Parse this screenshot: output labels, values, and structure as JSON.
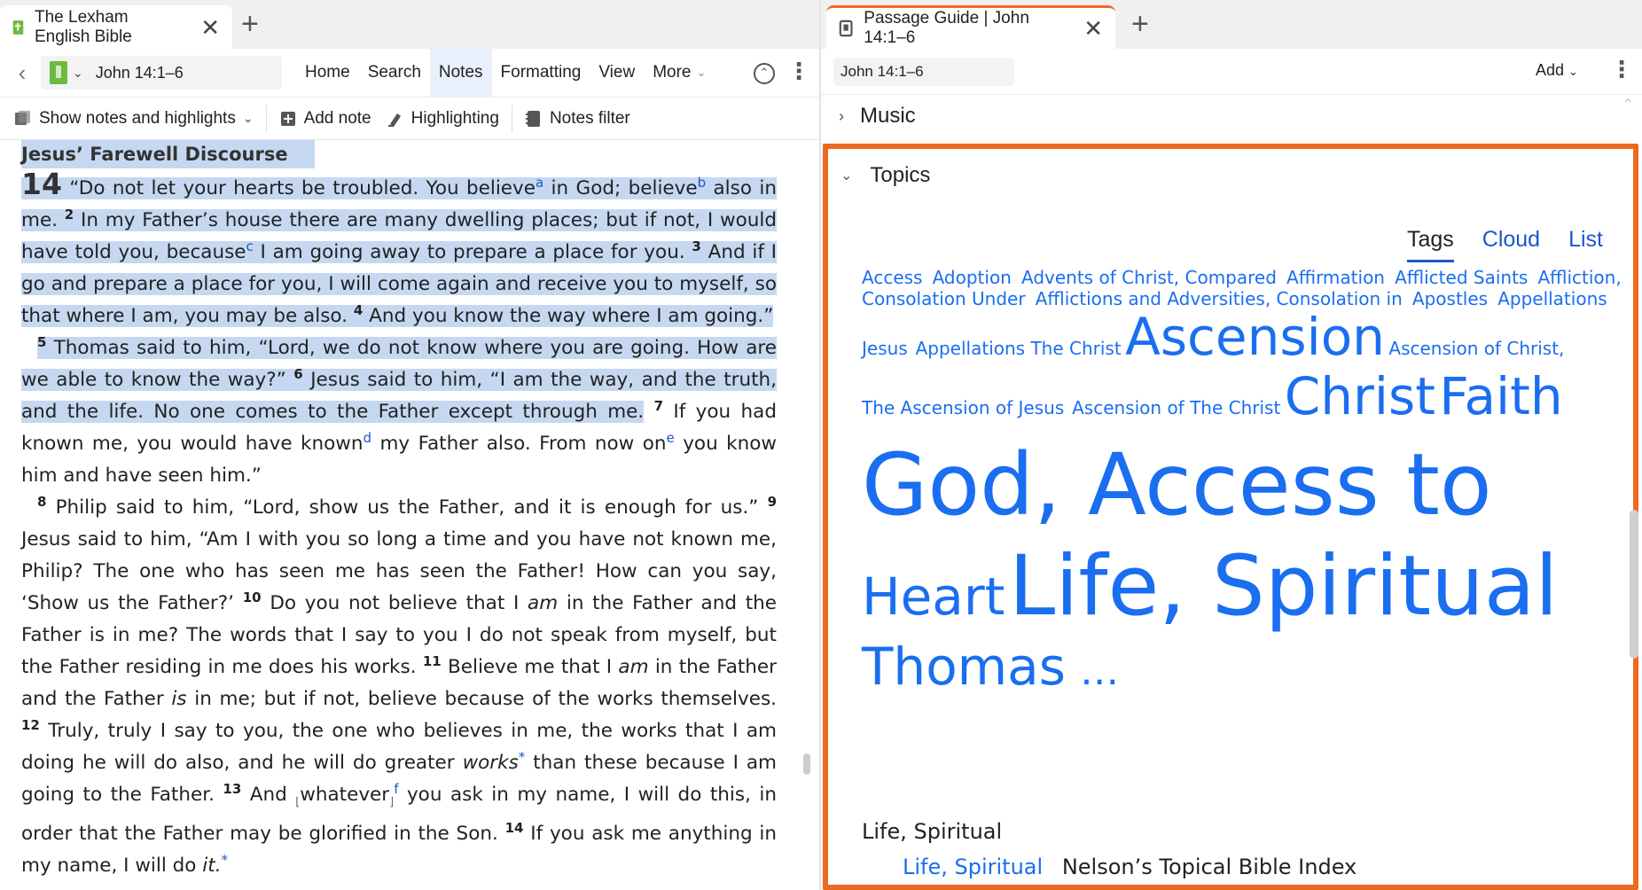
{
  "left": {
    "tab": {
      "title": "The Lexham English Bible",
      "close": "✕",
      "new_tab": "+"
    },
    "toolbar": {
      "back": "‹",
      "reference": "John 14:1–6",
      "menu": [
        "Home",
        "Search",
        "Notes",
        "Formatting",
        "View",
        "More"
      ],
      "active_menu": "Notes"
    },
    "notes_toolbar": {
      "show_notes": "Show notes and highlights",
      "add_note": "Add note",
      "highlighting": "Highlighting",
      "notes_filter": "Notes filter"
    },
    "text": {
      "heading": "Jesus’ Farewell Discourse",
      "chapter": "14",
      "v1a": " “Do not let your hearts be troubled. You believe",
      "fn_a": "a",
      "v1b": " in God; believe",
      "fn_b": "b",
      "v1c": " also in me.",
      "v2_num": "2",
      "v2a": " In my Father’s house there are many dwelling places; but if not, I would have told you, because",
      "fn_c": "c",
      "v2b": " I am going away to prepare a place for you.",
      "v3_num": "3",
      "v3": " And if I go and prepare a place for you, I will come again and receive you to myself, so that where I am, you may be also.",
      "v4_num": "4",
      "v4": " And you know the way where I am going.”",
      "v5_num": "5",
      "v5": " Thomas said to him, “Lord, we do not know where you are going. How are we able to know the way?”",
      "v6_num": "6",
      "v6": " Jesus said to him, “I am the way, and the truth, and the life. No one comes to the Father except through me.",
      "v7_num": "7",
      "v7a": " If you had known me, you would have known",
      "fn_d": "d",
      "v7b": " my Father also. From now on",
      "fn_e": "e",
      "v7c": " you know him and have seen him.”",
      "v8_num": "8",
      "v8": " Philip said to him, “Lord, show us the Father, and it is enough for us.”",
      "v9_num": "9",
      "v9": " Jesus said to him, “Am I with you so long a time and you have not known me, Philip? The one who has seen me has seen the Father! How can you say, ‘Show us the Father?’",
      "v10_num": "10",
      "v10a": " Do you not believe that I ",
      "v10_am": "am",
      "v10b": " in the Father and the Father is in me? The words that I say to you I do not speak from myself, but the Father residing in me does his works.",
      "v11_num": "11",
      "v11a": " Believe me that I ",
      "v11_am": "am",
      "v11b": " in the Father and the Father ",
      "v11_is": "is",
      "v11c": " in me; but if not, believe because of the works themselves.",
      "v12_num": "12",
      "v12a": " Truly, truly I say to you, the one who believes in me, the works that I am doing he will do also, and he will do greater ",
      "v12_works": "works",
      "v12_star": "*",
      "v12b": " than these because I am going to the Father.",
      "v13_num": "13",
      "v13a": " And ",
      "v13_bracket_open": "⌊",
      "v13_whatever": "whatever",
      "v13_bracket_close": "⌋",
      "fn_f": "f",
      "v13b": " you ask in my name, I will do this, in order that the Father may be glorified in the Son.",
      "v14_num": "14",
      "v14a": " If you ask me anything in my name, I will do ",
      "v14_it": "it.",
      "v14_star": "*"
    }
  },
  "right": {
    "tab": {
      "title": "Passage Guide | John 14:1–6",
      "close": "✕",
      "new_tab": "+"
    },
    "toolbar": {
      "reference": "John 14:1–6",
      "add": "Add"
    },
    "music": {
      "label": "Music"
    },
    "topics": {
      "label": "Topics",
      "views": [
        "Tags",
        "Cloud",
        "List"
      ],
      "active_view": "Tags",
      "tags": [
        "Access",
        "Adoption",
        "Advents of Christ, Compared",
        "Affirmation",
        "Afflicted Saints",
        "Affliction,",
        "Consolation Under",
        "Afflictions and Adversities, Consolation in",
        "Apostles",
        "Appellations",
        "Jesus",
        "Appellations The Christ",
        "Ascension",
        "Ascension of Christ,",
        "The Ascension of Jesus",
        "Ascension of The Christ",
        "Christ",
        "Faith",
        "God, Access to",
        "Heart",
        "Life, Spiritual",
        "Thomas",
        "…"
      ],
      "result_topic": "Life, Spiritual",
      "result_link": "Life, Spiritual",
      "result_source": "Nelson’s Topical Bible Index"
    }
  },
  "colors": {
    "accent": "#1a6ef0",
    "highlight": "#c6d8f1",
    "focus_border": "#ec6a1e",
    "logos_green": "#6dbb3e"
  },
  "icons": {
    "tab_left": "bible-book-icon",
    "tab_right": "passage-guide-icon",
    "back": "chevron-left-icon",
    "scroll_top": "circle-up-icon",
    "menu": "kebab-menu-icon"
  }
}
